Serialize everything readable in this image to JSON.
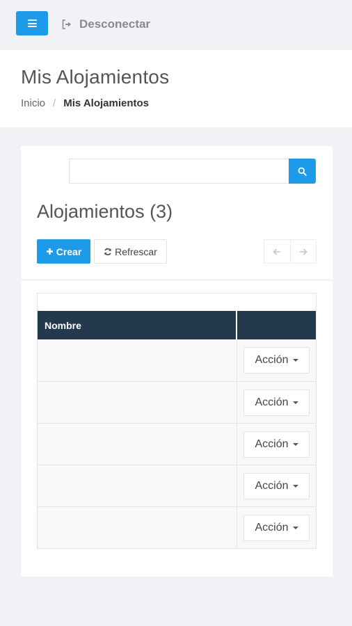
{
  "topbar": {
    "menu_icon": "hamburger-icon",
    "logout_icon": "sign-out-icon",
    "logout_label": "Desconectar"
  },
  "header": {
    "title": "Mis Alojamientos",
    "breadcrumb": [
      "Inicio",
      "Mis Alojamientos"
    ]
  },
  "search": {
    "value": "",
    "placeholder": "",
    "icon": "search-icon"
  },
  "section": {
    "title": "Alojamientos (3)"
  },
  "toolbar": {
    "create_label": "Crear",
    "create_icon": "plus-icon",
    "refresh_label": "Refrescar",
    "refresh_icon": "refresh-icon",
    "prev_icon": "arrow-left-icon",
    "next_icon": "arrow-right-icon"
  },
  "table": {
    "columns": [
      "Nombre",
      ""
    ],
    "rows": [
      {
        "name": "",
        "action_label": "Acción"
      },
      {
        "name": "",
        "action_label": "Acción"
      },
      {
        "name": "",
        "action_label": "Acción"
      },
      {
        "name": "",
        "action_label": "Acción"
      },
      {
        "name": "",
        "action_label": "Acción"
      }
    ]
  },
  "colors": {
    "accent": "#1e9be8",
    "table_header": "#25394e",
    "background": "#f1f2f5"
  }
}
